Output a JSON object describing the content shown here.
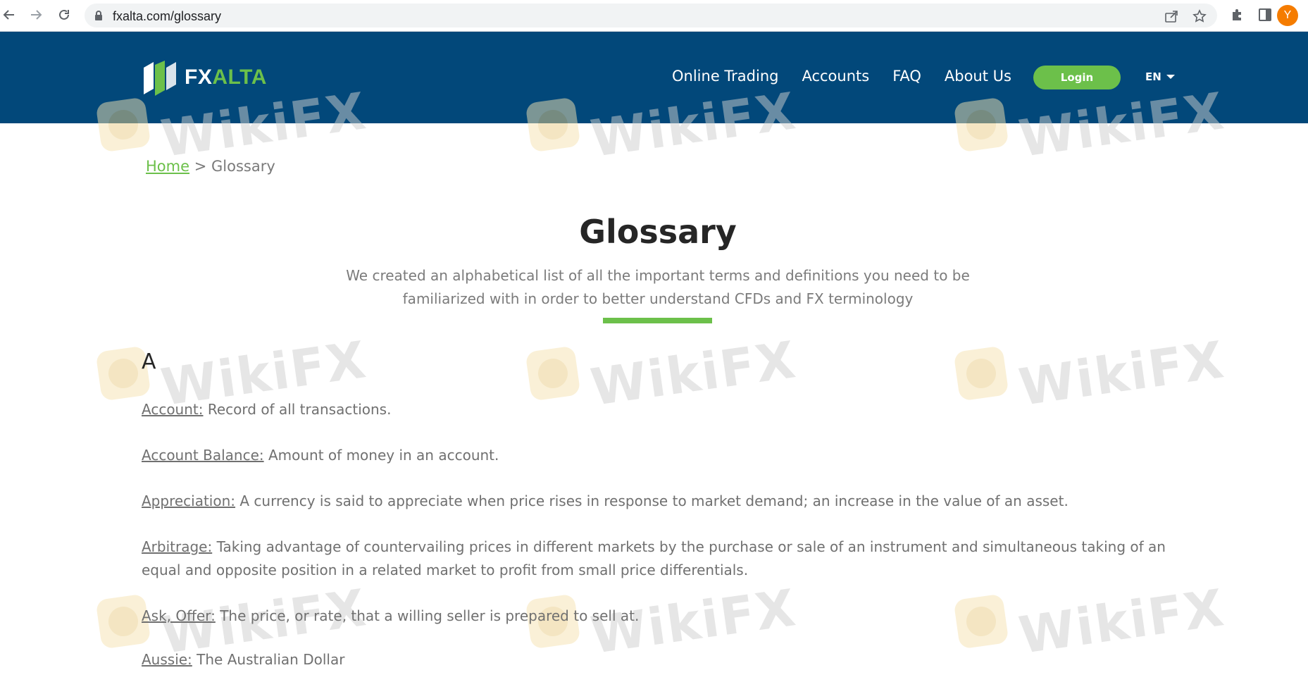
{
  "browser": {
    "url": "fxalta.com/glossary",
    "profile_initial": "Y"
  },
  "header": {
    "logo_fx": "FX",
    "logo_alta": "ALTA",
    "nav": [
      "Online Trading",
      "Accounts",
      "FAQ",
      "About Us"
    ],
    "login_label": "Login",
    "language": "EN"
  },
  "watermark": {
    "text": "WikiFX"
  },
  "breadcrumb": {
    "home": "Home",
    "separator": ">",
    "current": "Glossary"
  },
  "page": {
    "title": "Glossary",
    "intro_line1": "We created an alphabetical list of all the important terms and definitions you need to be",
    "intro_line2": "familiarized with in order to better understand CFDs and FX terminology",
    "letter": "A"
  },
  "terms": [
    {
      "name": "Account:",
      "definition": " Record of all transactions."
    },
    {
      "name": "Account Balance:",
      "definition": " Amount of money in an account."
    },
    {
      "name": "Appreciation:",
      "definition": " A currency is said to appreciate when price rises in response to market demand; an increase in the value of an asset."
    },
    {
      "name": "Arbitrage:",
      "definition": " Taking advantage of countervailing prices in different markets by the purchase or sale of an instrument and simultaneous taking of an equal and opposite position in a related market to profit from small price differentials."
    },
    {
      "name": "Ask, Offer:",
      "definition": " The price, or rate, that a willing seller is prepared to sell at."
    },
    {
      "name": "Aussie:",
      "definition": " The Australian Dollar"
    }
  ],
  "colors": {
    "header_bg": "#02487a",
    "accent": "#6cc04a",
    "title": "#262626"
  }
}
